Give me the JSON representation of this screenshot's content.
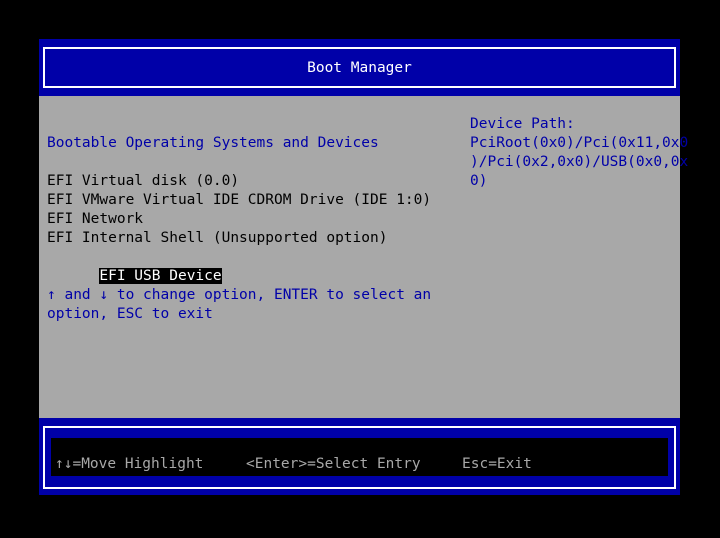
{
  "header": {
    "title": "Boot Manager"
  },
  "main": {
    "section_title": "Bootable Operating Systems and Devices",
    "boot_options": [
      "EFI Virtual disk (0.0)",
      "EFI VMware Virtual IDE CDROM Drive (IDE 1:0)",
      "EFI Network",
      "EFI Internal Shell (Unsupported option)",
      "EFI USB Device"
    ],
    "selected_index": 4,
    "help_lines": [
      "↑ and ↓ to change option, ENTER to select an",
      "option, ESC to exit"
    ]
  },
  "device_path": {
    "label": "Device Path:",
    "lines": [
      "PciRoot(0x0)/Pci(0x11,0x0",
      ")/Pci(0x2,0x0)/USB(0x0,0x",
      "0)"
    ]
  },
  "footer": {
    "move": "↑↓=Move Highlight",
    "select": "<Enter>=Select Entry",
    "exit": "Esc=Exit"
  },
  "colors": {
    "background": "#000000",
    "panel": "#a8a8a8",
    "blue": "#0000a8",
    "highlight_bg": "#000000",
    "highlight_fg": "#ffffff"
  }
}
